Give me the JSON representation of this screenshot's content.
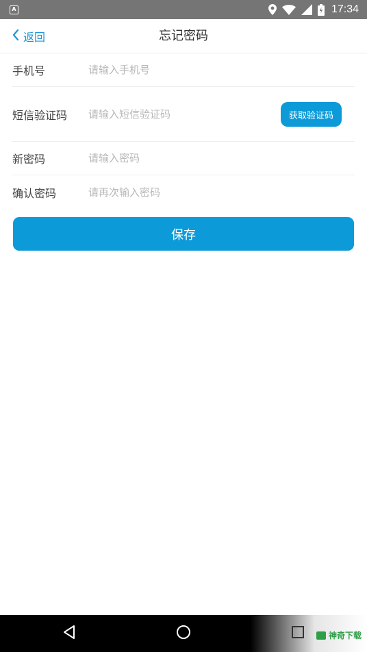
{
  "status_bar": {
    "notification_icon": "a-letter-icon",
    "icons": [
      "location-icon",
      "wifi-icon",
      "signal-icon",
      "battery-charging-icon"
    ],
    "time": "17:34"
  },
  "header": {
    "back_label": "返回",
    "title": "忘记密码"
  },
  "form": {
    "phone": {
      "label": "手机号",
      "placeholder": "请输入手机号"
    },
    "sms_code": {
      "label": "短信验证码",
      "placeholder": "请输入短信验证码",
      "button_label": "获取验证码"
    },
    "new_password": {
      "label": "新密码",
      "placeholder": "请输入密码"
    },
    "confirm_password": {
      "label": "确认密码",
      "placeholder": "请再次输入密码"
    }
  },
  "save_label": "保存",
  "colors": {
    "accent": "#0d9ad8",
    "link": "#1a96d4",
    "status_bar": "#757575",
    "nav_bar": "#000000"
  },
  "nav_bar": {
    "buttons": [
      "back-triangle-icon",
      "home-circle-icon",
      "recents-square-icon"
    ]
  },
  "watermark": {
    "text": "神奇下载"
  }
}
